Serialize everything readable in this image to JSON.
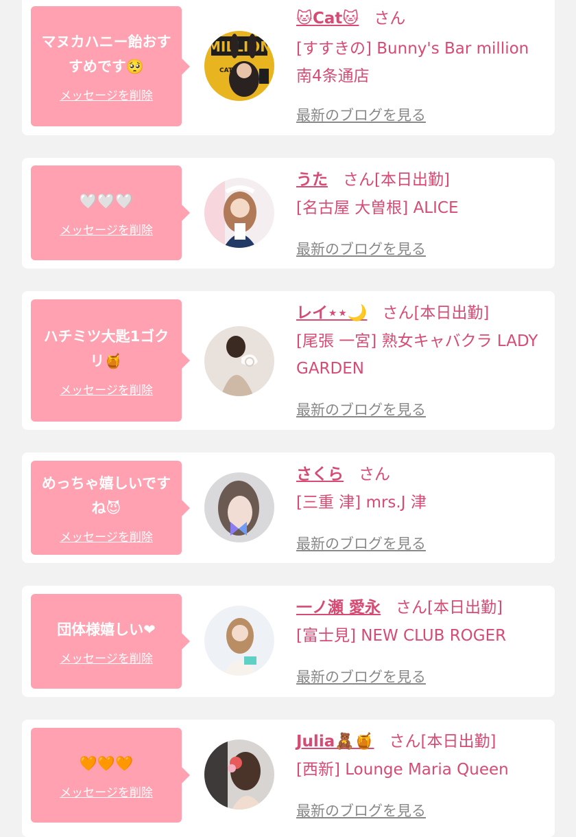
{
  "delete_label": "メッセージを削除",
  "blog_label": "最新のブログを見る",
  "colors": {
    "accent": "#d64b73",
    "bubble": "#ffa1b0",
    "link_gray": "#888888",
    "background": "#f2f2f2"
  },
  "items": [
    {
      "message": "マヌカハニー飴おすすめです🥺",
      "name": "🐱Cat🐱",
      "suffix": "さん",
      "shop": "[すすきの] Bunny's Bar million 南4条通店"
    },
    {
      "message": "🤍🤍🤍",
      "name": "うた",
      "suffix": "さん[本日出勤]",
      "shop": "[名古屋 大曽根] ALICE"
    },
    {
      "message": "ハチミツ大匙1ゴクリ🍯",
      "name": "レイ⋆⋆🌙",
      "suffix": "さん[本日出勤]",
      "shop": "[尾張 一宮] 熟女キャバクラ LADY GARDEN"
    },
    {
      "message": "めっちゃ嬉しいですね😈",
      "name": "さくら",
      "suffix": "さん",
      "shop": "[三重 津] mrs.J 津"
    },
    {
      "message": "団体様嬉しい❤",
      "name": "一ノ瀬 愛永",
      "suffix": "さん[本日出勤]",
      "shop": "[富士見] NEW CLUB ROGER"
    },
    {
      "message": "🧡🧡🧡",
      "name": "Julia🧸🍯",
      "suffix": "さん[本日出勤]",
      "shop": "[西新] Lounge Maria Queen"
    }
  ]
}
